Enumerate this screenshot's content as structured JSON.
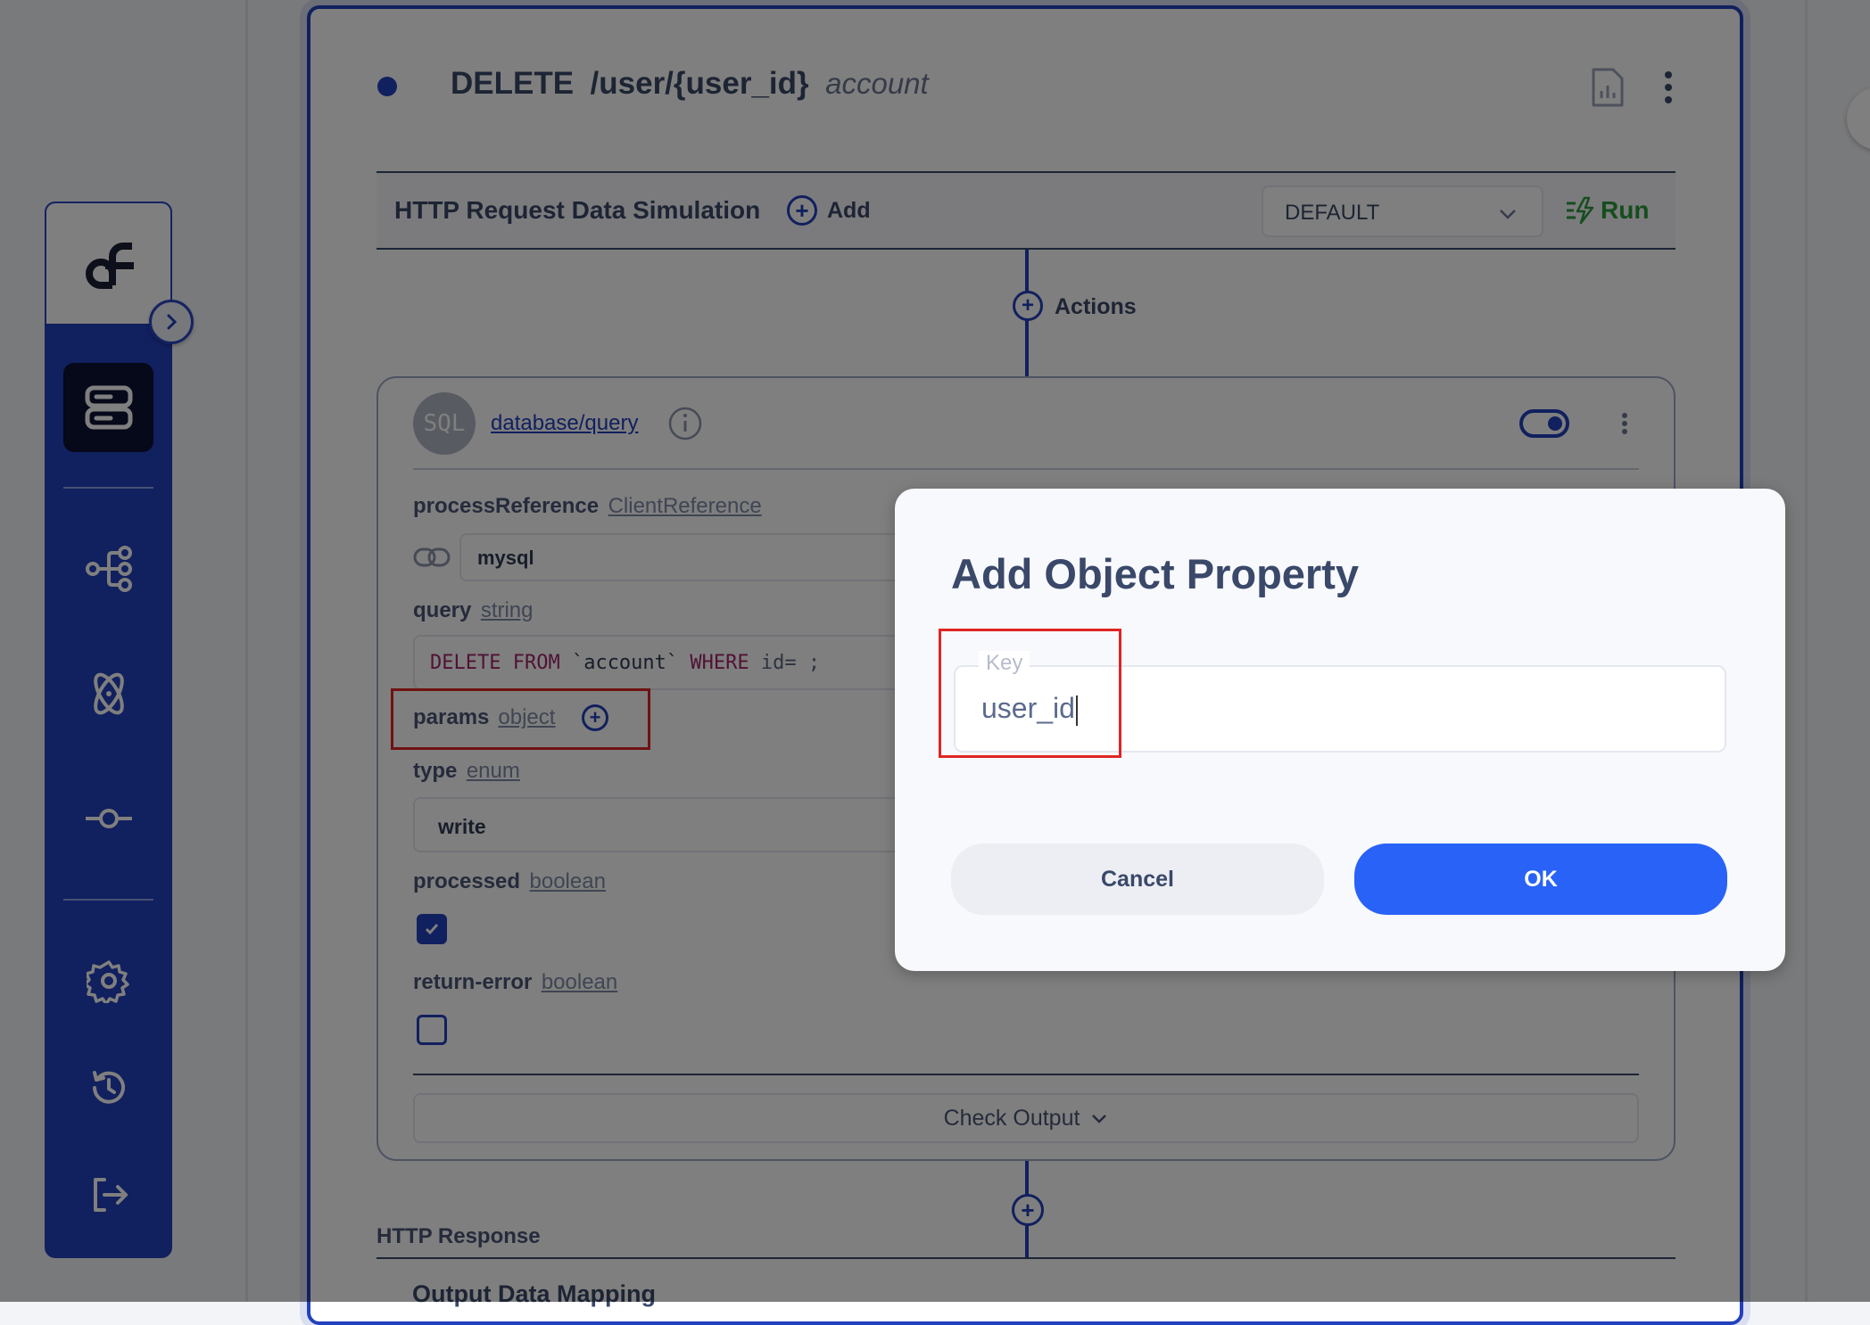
{
  "endpoint": {
    "method": "DELETE",
    "path": "/user/{user_id}",
    "name": "account"
  },
  "simulation": {
    "title": "HTTP Request Data Simulation",
    "add_label": "Add",
    "profile_value": "DEFAULT",
    "run_label": "Run"
  },
  "actions_label": "Actions",
  "action": {
    "badge": "SQL",
    "link": "database/query",
    "fields": {
      "processReference_label": "processReference",
      "processReference_type": "ClientReference",
      "processReference_value": "mysql",
      "query_label": "query",
      "query_type": "string",
      "query_kw1": "DELETE FROM",
      "query_table": "`account`",
      "query_kw2": "WHERE",
      "query_rest": "id= ;",
      "params_label": "params",
      "params_type": "object",
      "type_label": "type",
      "type_type": "enum",
      "type_value": "write",
      "processed_label": "processed",
      "processed_type": "boolean",
      "processed_checked": true,
      "return_error_label": "return-error",
      "return_error_type": "boolean",
      "return_error_checked": false
    },
    "check_output_label": "Check Output"
  },
  "response": {
    "title": "HTTP Response",
    "output_mapping": "Output Data Mapping"
  },
  "modal": {
    "title": "Add Object Property",
    "key_label": "Key",
    "key_value": "user_id",
    "cancel_label": "Cancel",
    "ok_label": "OK"
  },
  "colors": {
    "accent": "#2340bd",
    "primary_button": "#2962f6",
    "run_green": "#2c9b3c",
    "highlight_red": "#e02424"
  }
}
